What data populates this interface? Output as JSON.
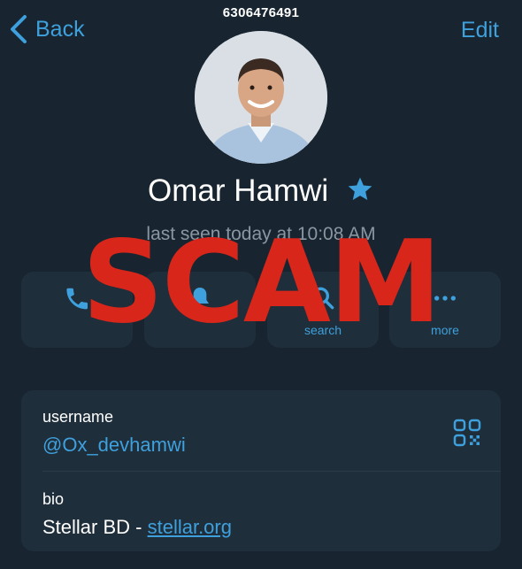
{
  "topbar": {
    "id_text": "6306476491",
    "back_label": "Back",
    "edit_label": "Edit"
  },
  "profile": {
    "name": "Omar Hamwi",
    "last_seen": "last seen today at 10:08 AM"
  },
  "actions": [
    {
      "label": "",
      "icon": "phone-icon"
    },
    {
      "label": "",
      "icon": "bell-icon"
    },
    {
      "label": "search",
      "icon": "search-icon"
    },
    {
      "label": "more",
      "icon": "more-icon"
    }
  ],
  "info": {
    "username_label": "username",
    "username_value": "@Ox_devhamwi",
    "bio_label": "bio",
    "bio_text": "Stellar BD - ",
    "bio_link": "stellar.org"
  },
  "overlay": {
    "stamp_text": "SCAM"
  },
  "colors": {
    "background": "#182530",
    "card": "#1f2e3b",
    "accent": "#3ea0dc",
    "stamp": "#d8261a"
  }
}
